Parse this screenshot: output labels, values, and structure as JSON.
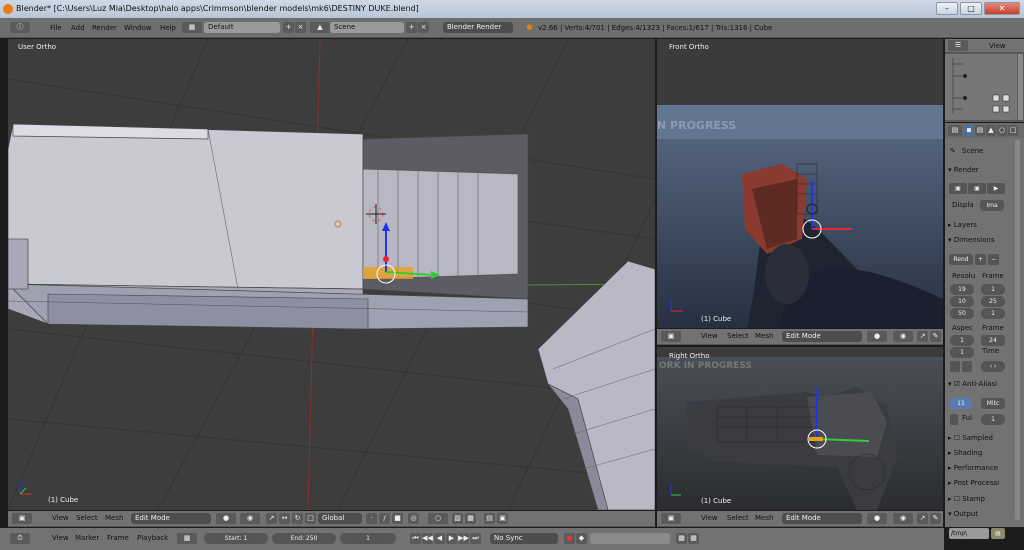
{
  "window": {
    "title": "Blender* [C:\\Users\\Luz Mia\\Desktop\\halo apps\\Crimmson\\blender models\\mk6\\DESTINY DUKE.blend]",
    "minimize": "–",
    "maximize": "□",
    "close": "✕"
  },
  "menubar": {
    "menus": [
      "File",
      "Add",
      "Render",
      "Window",
      "Help"
    ],
    "layout": "Default",
    "scene": "Scene",
    "engine": "Blender Render",
    "stats": "v2.66 | Verts:4/701 | Edges:4/1323 | Faces:1/617 | Tris:1316 | Cube"
  },
  "viewport_main": {
    "label": "User Ortho",
    "object": "(1) Cube"
  },
  "viewport_front": {
    "label": "Front Ortho",
    "object": "(1) Cube",
    "watermark": "N PROGRESS"
  },
  "viewport_right": {
    "label": "Right Ortho",
    "object": "(1) Cube",
    "watermark": "ORK IN PROGRESS"
  },
  "header3d": {
    "menus": [
      "View",
      "Select",
      "Mesh"
    ],
    "mode": "Edit Mode",
    "orientation": "Global"
  },
  "outliner": {
    "view": "View"
  },
  "properties": {
    "scene": "Scene",
    "render": "Render",
    "display_label": "Displa",
    "display_value": "Ima",
    "layers": "Layers",
    "dimensions": "Dimensions",
    "preset": "Rend",
    "resolution_label": "Resolu",
    "frame_label": "Frame",
    "res_x": "19",
    "res_y": "10",
    "res_pct": "50",
    "frame_start": "1",
    "frame_end": "25",
    "frame_step": "1",
    "aspect_label": "Aspec",
    "frame_rate_label": "Frame",
    "frame_rate": "24",
    "aspect_x": "1",
    "aspect_y": "1",
    "time_label": "Time",
    "anti_alias": "Anti-Aliasi",
    "aa_samples": "11",
    "aa_filter": "Mitc",
    "full": "Ful",
    "full_val": "1",
    "sampled": "Sampled",
    "shading": "Shading",
    "performance": "Performance",
    "post_processing": "Post Processi",
    "stamp": "Stamp",
    "output": "Output",
    "output_path": "/tmp\\"
  },
  "timeline": {
    "menus": [
      "View",
      "Marker",
      "Frame",
      "Playback"
    ],
    "start": "Start: 1",
    "end": "End: 250",
    "current": "1",
    "sync": "No Sync"
  },
  "colors": {
    "viewport_bg": "#3d3d3d",
    "header": "#727272",
    "x_axis": "#e23",
    "y_axis": "#3c3",
    "z_axis": "#23e",
    "mesh": "#c8c8d0"
  },
  "icons": [
    "blender-logo-icon",
    "info-editor-icon",
    "screen-layout-icon",
    "scene-icon",
    "render-engine-icon",
    "view3d-editor-icon",
    "viewport-shading-icon",
    "pivot-icon",
    "manipulator-icon",
    "snap-icon",
    "camera-icon",
    "render-icon",
    "timeline-icon",
    "play-icon",
    "record-icon",
    "keyframe-icon"
  ]
}
